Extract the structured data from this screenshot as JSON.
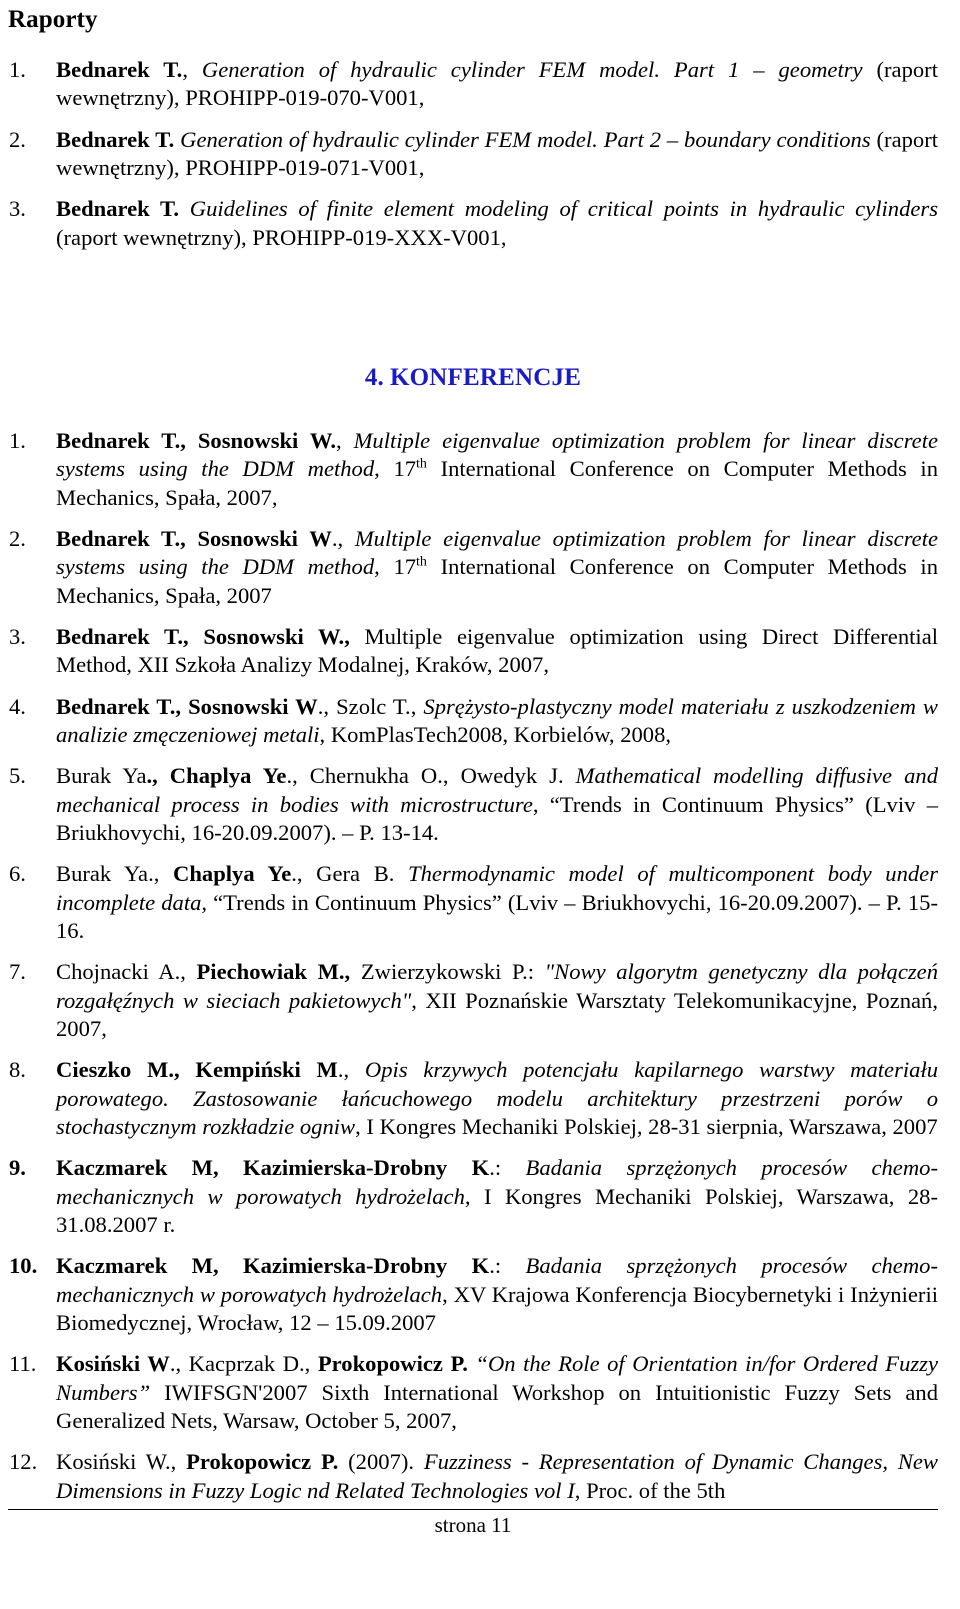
{
  "page": {
    "footer_label": "strona 11",
    "heading_color": "#1b1bc4"
  },
  "reports_section": {
    "title": "Raporty",
    "items": [
      {
        "number": "1.",
        "authors": "Bednarek T.",
        "title_italic": "Generation of hydraulic cylinder FEM model. Part 1 – geometry",
        "rest": "(raport wewnętrzny), PROHIPP-019-070-V001,",
        "separator": ", "
      },
      {
        "number": "2.",
        "authors": "Bednarek T.",
        "title_italic": "Generation of hydraulic cylinder FEM model. Part 2 – boundary conditions",
        "rest": "(raport wewnętrzny), PROHIPP-019-071-V001,",
        "separator": " "
      },
      {
        "number": "3.",
        "authors": "Bednarek T.",
        "title_italic": "Guidelines of finite element modeling of critical points in hydraulic cylinders",
        "rest": "(raport wewnętrzny), PROHIPP-019-XXX-V001,",
        "separator": " "
      }
    ]
  },
  "conferences_section": {
    "heading_number": "4.",
    "heading_text": "KONFERENCJE",
    "items": [
      {
        "number": "1.",
        "authors_bold": "Bednarek T., Sosnowski W.",
        "after_authors": ", ",
        "title_italic": "Multiple eigenvalue optimization problem for linear discrete systems using the DDM method",
        "tail_pre": ", 17",
        "tail_sup": "th",
        "tail_post": " International Conference on Computer Methods in Mechanics, Spała, 2007,"
      },
      {
        "number": "2.",
        "authors_bold": "Bednarek T., Sosnowski W",
        "after_authors": "., ",
        "title_italic": "Multiple eigenvalue optimization problem for linear discrete systems using the DDM method",
        "tail_pre": ", 17",
        "tail_sup": "th",
        "tail_post": " International Conference on Computer Methods in Mechanics, Spała, 2007"
      },
      {
        "number": "3.",
        "authors_bold": "Bednarek T., Sosnowski W.,",
        "after_authors": " ",
        "title_italic": "",
        "tail_pre": "",
        "tail_sup": "",
        "tail_post": "Multiple eigenvalue optimization using Direct Differential Method, XII Szkoła Analizy Modalnej, Kraków, 2007,"
      },
      {
        "number": "4.",
        "authors_bold": "Bednarek T., Sosnowski W",
        "after_authors": "., Szolc T., ",
        "title_italic": "Sprężysto-plastyczny model materiału z uszkodzeniem w analizie zmęczeniowej metali",
        "tail_pre": "",
        "tail_sup": "",
        "tail_post": ", KomPlasTech2008, Korbielów, 2008,"
      },
      {
        "number": "5.",
        "authors_plain_pre": "Burak Ya",
        "authors_bold": "., Chaplya Ye",
        "after_authors": "., Chernukha O., Owedyk J. ",
        "title_italic": "Mathematical modelling diffusive and mechanical process in bodies with microstructure",
        "tail_pre": "",
        "tail_sup": "",
        "tail_post": ", “Trends in Continuum Physics” (Lviv – Briukhovychi, 16-20.09.2007). – P. 13-14."
      },
      {
        "number": "6.",
        "authors_plain_pre": "Burak Ya., ",
        "authors_bold": "Chaplya Ye",
        "after_authors": "., Gera B. ",
        "title_italic": "Thermodynamic model of multicomponent body under incomplete data,",
        "tail_pre": "",
        "tail_sup": "",
        "tail_post": " “Trends in Continuum Physics” (Lviv – Briukhovychi, 16-20.09.2007). – P. 15-16."
      },
      {
        "number": "7.",
        "authors_plain_pre": "Chojnacki A., ",
        "authors_bold": "Piechowiak M.,",
        "after_authors": " Zwierzykowski P.: ",
        "title_italic": "\"Nowy algorytm genetyczny dla połączeń rozgałęźnych w sieciach pakietowych\"",
        "tail_pre": "",
        "tail_sup": "",
        "tail_post": ", XII Poznańskie Warsztaty Telekomunikacyjne, Poznań, 2007,"
      },
      {
        "number": "8.",
        "authors_bold": "Cieszko M., Kempiński M",
        "after_authors": "., ",
        "title_italic": "Opis krzywych potencjału kapilarnego warstwy materiału porowatego. Zastosowanie łańcuchowego modelu architektury przestrzeni porów o stochastycznym rozkładzie ogniw",
        "tail_pre": "",
        "tail_sup": "",
        "tail_post": ", I Kongres Mechaniki Polskiej, 28-31 sierpnia, Warszawa, 2007"
      },
      {
        "number": "9.",
        "number_bold": true,
        "authors_bold": "Kaczmarek M, Kazimierska-Drobny K",
        "after_authors": ".: ",
        "title_italic": "Badania sprzężonych procesów chemo-mechanicznych w porowatych hydrożelach",
        "tail_pre": "",
        "tail_sup": "",
        "tail_post": ", I Kongres Mechaniki Polskiej, Warszawa, 28-31.08.2007 r."
      },
      {
        "number": "10.",
        "number_bold": true,
        "authors_bold": "Kaczmarek M, Kazimierska-Drobny K",
        "after_authors": ".: ",
        "title_italic": "Badania sprzężonych procesów chemo-mechanicznych w porowatych hydrożelach",
        "tail_pre": "",
        "tail_sup": "",
        "tail_post": ", XV Krajowa Konferencja Biocybernetyki i Inżynierii Biomedycznej, Wrocław,  12 – 15.09.2007"
      },
      {
        "number": "11.",
        "authors_bold": "Kosiński W",
        "after_authors": "., Kacprzak D., ",
        "authors_bold2": "Prokopowicz P.",
        "after_authors2": " ",
        "title_italic": "“On the Role of Orientation in/for Ordered Fuzzy Numbers”",
        "tail_pre": "",
        "tail_sup": "",
        "tail_post": " IWIFSGN'2007 Sixth International Workshop on Intuitionistic Fuzzy Sets and Generalized Nets, Warsaw, October 5, 2007,"
      },
      {
        "number": "12.",
        "authors_plain_pre": "Kosiński W., ",
        "authors_bold": "Prokopowicz P.",
        "after_authors": " (2007). ",
        "title_italic": "Fuzziness - Representation of Dynamic Changes, New Dimensions in Fuzzy Logic nd Related Technologies vol I",
        "tail_pre": "",
        "tail_sup": "",
        "tail_post": ", Proc. of the 5th"
      }
    ]
  }
}
